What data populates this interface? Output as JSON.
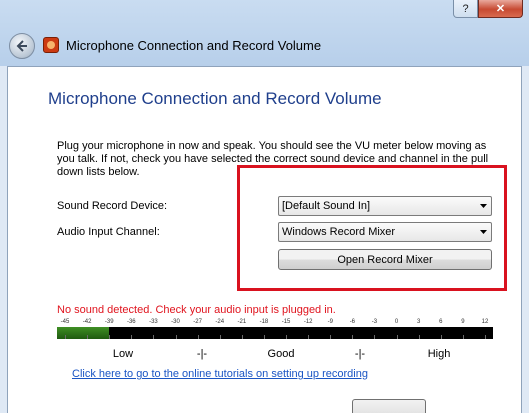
{
  "window": {
    "title": "Microphone Connection and Record Volume",
    "help_label": "?",
    "close_label": "✕"
  },
  "page": {
    "heading": "Microphone Connection and Record Volume",
    "intro": "Plug your microphone in now and speak.  You should see the VU meter below moving as you talk.  If not, check you have selected the correct sound device and channel in the pull down lists below."
  },
  "form": {
    "device_label": "Sound Record Device:",
    "device_value": "[Default Sound In]",
    "channel_label": "Audio Input Channel:",
    "channel_value": "Windows Record Mixer",
    "mixer_button": "Open Record Mixer"
  },
  "status": {
    "message": "No sound detected. Check your audio input is plugged in.",
    "color": "#e0141e"
  },
  "vu_meter": {
    "scale": [
      "-45",
      "-42",
      "-39",
      "-36",
      "-33",
      "-30",
      "-27",
      "-24",
      "-21",
      "-18",
      "-15",
      "-12",
      "-9",
      "-6",
      "-3",
      "0",
      "3",
      "6",
      "9",
      "12"
    ],
    "level_fraction": 0.12,
    "level_labels": [
      "Low",
      "-|-",
      "Good",
      "-|-",
      "High"
    ]
  },
  "link": {
    "tutorials": "Click here to go to the online tutorials on setting up recording"
  },
  "colors": {
    "heading": "#1f3f8c",
    "highlight": "#d9121f",
    "link": "#1a55c4"
  }
}
